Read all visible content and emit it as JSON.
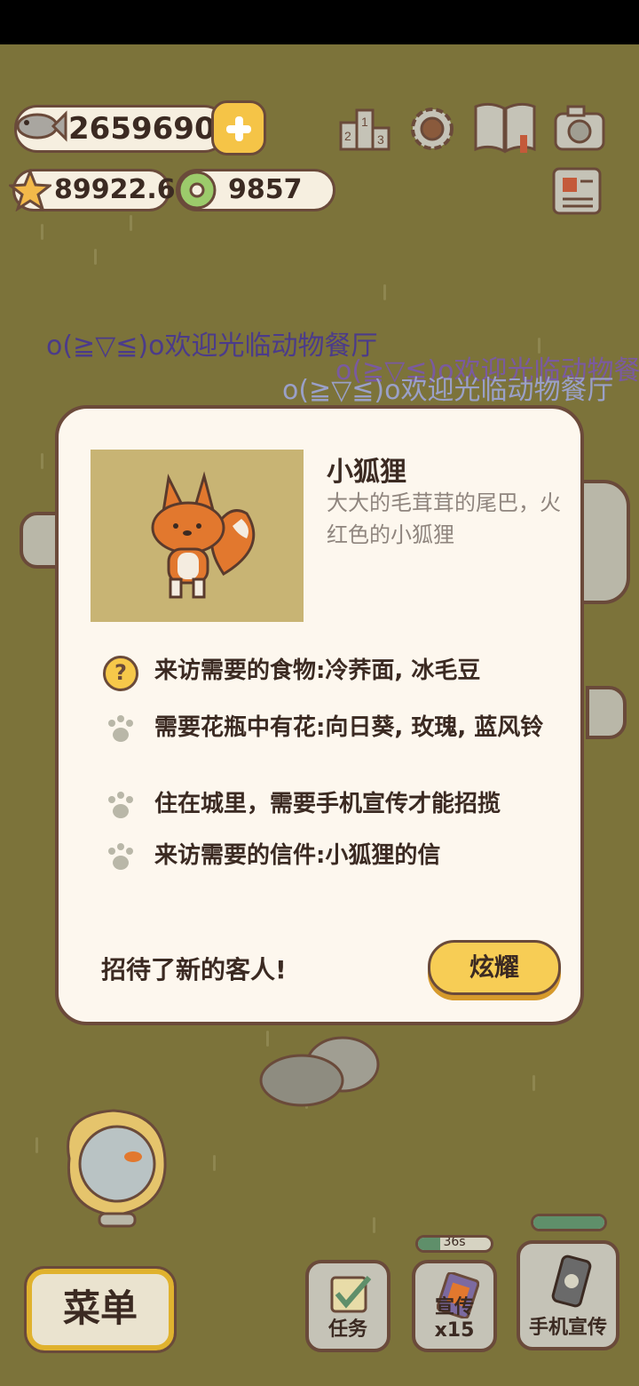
{
  "currencies": {
    "fish": "2659690",
    "stars": "89922.6",
    "donuts": "9857"
  },
  "welcome_text": "o(≧▽≦)o欢迎光临动物餐厅",
  "dialog": {
    "animal_name": "小狐狸",
    "description": "大大的毛茸茸的尾巴，火红色的小狐狸",
    "requirements": [
      {
        "icon": "question-icon",
        "text": "来访需要的食物:冷荞面, 冰毛豆"
      },
      {
        "icon": "paw-icon",
        "text": "需要花瓶中有花:向日葵, 玫瑰, 蓝风铃"
      },
      {
        "icon": "paw-icon",
        "text": "住在城里，需要手机宣传才能招揽"
      },
      {
        "icon": "paw-icon",
        "text": "来访需要的信件:小狐狸的信"
      }
    ],
    "footer_text": "招待了新的客人!",
    "show_button": "炫耀"
  },
  "bottom": {
    "menu_label": "菜单",
    "tasks_label": "任务",
    "promo_label": "宣传x15",
    "promo_timer": "36s",
    "phone_label": "手机宣传"
  },
  "colors": {
    "background": "#7c733a",
    "modal_bg": "#fdf7ee",
    "accent_yellow": "#f7cd55",
    "outline": "#6a4a3a",
    "welcome_purple": "#4b3b8a"
  }
}
